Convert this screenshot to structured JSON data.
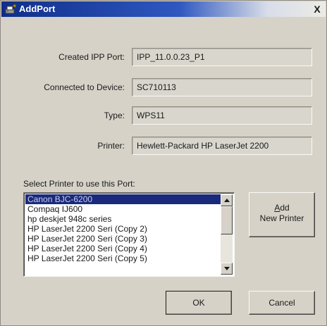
{
  "window": {
    "title": "AddPort",
    "close_glyph": "X",
    "icon": "printer-port-icon"
  },
  "fields": [
    {
      "label": "Created IPP Port:",
      "value": "IPP_11.0.0.23_P1"
    },
    {
      "label": "Connected to Device:",
      "value": "SC710113"
    },
    {
      "label": "Type:",
      "value": "WPS11"
    },
    {
      "label": "Printer:",
      "value": "Hewlett-Packard HP LaserJet 2200"
    }
  ],
  "printer_list": {
    "label": "Select Printer to use this Port:",
    "items": [
      "Canon BJC-6200",
      "Compaq IJ600",
      "hp deskjet 948c series",
      "HP LaserJet 2200 Seri (Copy 2)",
      "HP LaserJet 2200 Seri (Copy 3)",
      "HP LaserJet 2200 Seri (Copy 4)",
      "HP LaserJet 2200 Seri (Copy 5)"
    ],
    "selected": "Canon BJC-6200"
  },
  "buttons": {
    "add_line1_accel": "A",
    "add_line1_rest": "dd",
    "add_line2": "New Printer",
    "ok": "OK",
    "cancel": "Cancel"
  },
  "colors": {
    "title_gradient_start": "#0f2e8a",
    "selection": "#1a2a7a",
    "dialog_face": "#d6d2c8"
  }
}
